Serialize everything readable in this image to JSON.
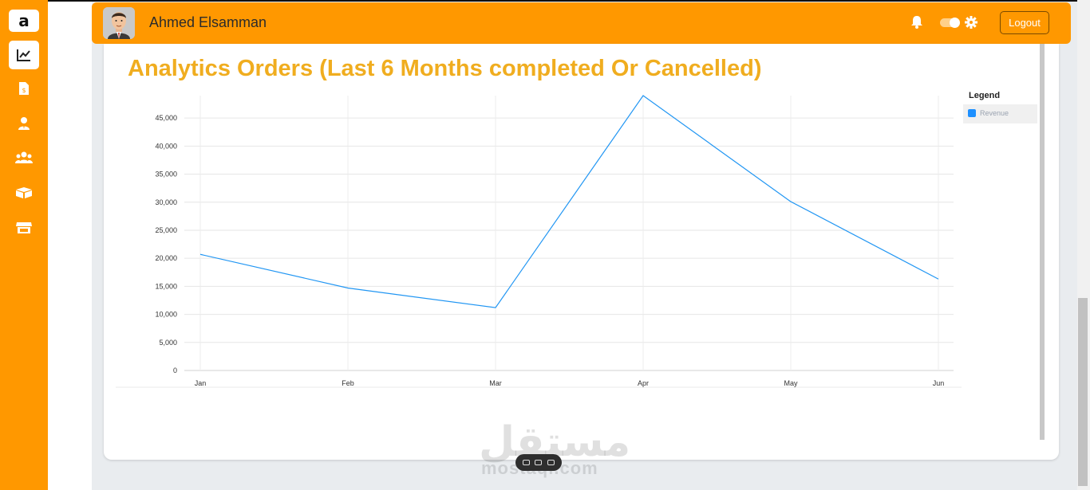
{
  "sidebar": {
    "logo": "a",
    "items": [
      {
        "icon": "chart-line-icon"
      },
      {
        "icon": "invoice-dollar-icon"
      },
      {
        "icon": "user-tie-icon"
      },
      {
        "icon": "users-icon"
      },
      {
        "icon": "boxes-icon"
      },
      {
        "icon": "store-icon"
      }
    ]
  },
  "header": {
    "username": "Ahmed Elsamman",
    "logout_label": "Logout",
    "accent_color": "#ff9800"
  },
  "chart_data": {
    "type": "line",
    "title": "Analytics Orders (Last 6 Months completed Or Cancelled)",
    "categories": [
      "Jan",
      "Feb",
      "Mar",
      "Apr",
      "May",
      "Jun"
    ],
    "series": [
      {
        "name": "Revenue",
        "values": [
          20700,
          14700,
          11200,
          49000,
          30100,
          16300
        ],
        "color": "#2196f3"
      }
    ],
    "yticks": [
      0,
      5000,
      10000,
      15000,
      20000,
      25000,
      30000,
      35000,
      40000,
      45000
    ],
    "ytick_labels": [
      "0",
      "5,000",
      "10,000",
      "15,000",
      "20,000",
      "25,000",
      "30,000",
      "35,000",
      "40,000",
      "45,000"
    ],
    "ylim": [
      0,
      49000
    ],
    "grid": true,
    "legend_title": "Legend",
    "legend_position": "top-right"
  },
  "watermark": {
    "arabic": "مستقل",
    "latin": "mostaql.com"
  }
}
